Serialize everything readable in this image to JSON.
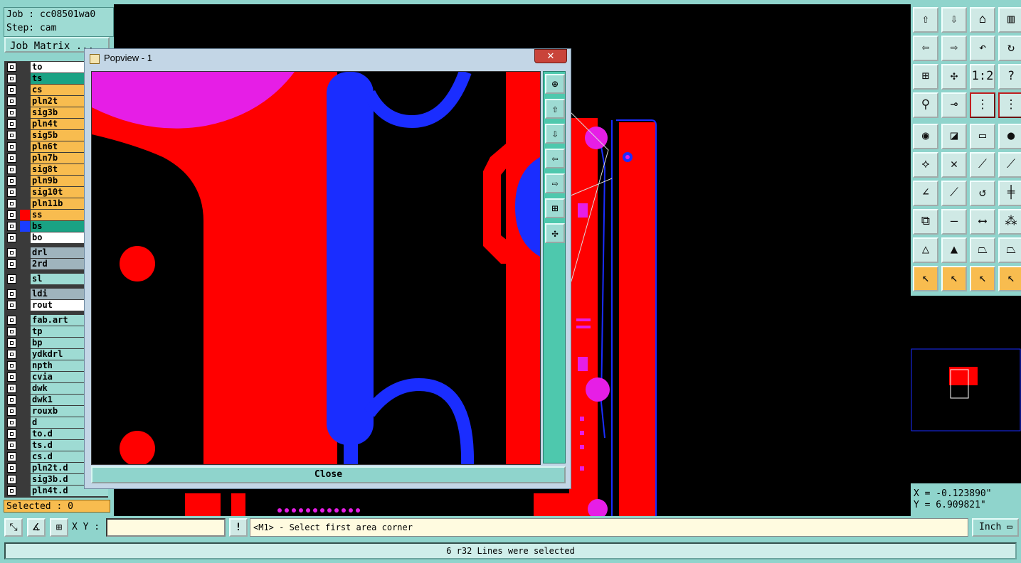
{
  "job": {
    "job_line": "Job : cc08501wa0",
    "step_line": "Step: cam",
    "matrix_label": "Job Matrix ..."
  },
  "layers": [
    {
      "name": "to",
      "fill": "#ffffff",
      "color": ""
    },
    {
      "name": "ts",
      "fill": "#1aa284",
      "color": ""
    },
    {
      "name": "cs",
      "fill": "#f8bc4f",
      "color": ""
    },
    {
      "name": "pln2t",
      "fill": "#f8bc4f",
      "color": ""
    },
    {
      "name": "sig3b",
      "fill": "#f8bc4f",
      "color": ""
    },
    {
      "name": "pln4t",
      "fill": "#f8bc4f",
      "color": ""
    },
    {
      "name": "sig5b",
      "fill": "#f8bc4f",
      "color": ""
    },
    {
      "name": "pln6t",
      "fill": "#f8bc4f",
      "color": ""
    },
    {
      "name": "pln7b",
      "fill": "#f8bc4f",
      "color": ""
    },
    {
      "name": "sig8t",
      "fill": "#f8bc4f",
      "color": ""
    },
    {
      "name": "pln9b",
      "fill": "#f8bc4f",
      "color": ""
    },
    {
      "name": "sig10t",
      "fill": "#f8bc4f",
      "color": ""
    },
    {
      "name": "pln11b",
      "fill": "#f8bc4f",
      "color": ""
    },
    {
      "name": "ss",
      "fill": "#f8bc4f",
      "color": "#ff0000"
    },
    {
      "name": "bs",
      "fill": "#1aa284",
      "color": "#1a3dff"
    },
    {
      "name": "bo",
      "fill": "#ffffff",
      "color": ""
    },
    {
      "name": "drl",
      "fill": "#9fb4bd",
      "color": ""
    },
    {
      "name": "2rd",
      "fill": "#9fb4bd",
      "color": ""
    },
    {
      "name": "sl",
      "fill": "#9edbd3",
      "color": ""
    },
    {
      "name": "ldi",
      "fill": "#9fb4bd",
      "color": ""
    },
    {
      "name": "rout",
      "fill": "#ffffff",
      "color": ""
    },
    {
      "name": "fab.art",
      "fill": "#9edbd3",
      "color": ""
    },
    {
      "name": "tp",
      "fill": "#9edbd3",
      "color": ""
    },
    {
      "name": "bp",
      "fill": "#9edbd3",
      "color": ""
    },
    {
      "name": "ydkdrl",
      "fill": "#9edbd3",
      "color": ""
    },
    {
      "name": "npth",
      "fill": "#9edbd3",
      "color": ""
    },
    {
      "name": "cvia",
      "fill": "#9edbd3",
      "color": ""
    },
    {
      "name": "dwk",
      "fill": "#9edbd3",
      "color": ""
    },
    {
      "name": "dwk1",
      "fill": "#9edbd3",
      "color": ""
    },
    {
      "name": "rouxb",
      "fill": "#9edbd3",
      "color": ""
    },
    {
      "name": "d",
      "fill": "#9edbd3",
      "color": ""
    },
    {
      "name": "to.d",
      "fill": "#9edbd3",
      "color": ""
    },
    {
      "name": "ts.d",
      "fill": "#9edbd3",
      "color": ""
    },
    {
      "name": "cs.d",
      "fill": "#9edbd3",
      "color": ""
    },
    {
      "name": "pln2t.d",
      "fill": "#9edbd3",
      "color": ""
    },
    {
      "name": "sig3b.d",
      "fill": "#9edbd3",
      "color": ""
    },
    {
      "name": "pln4t.d",
      "fill": "#9edbd3",
      "color": ""
    }
  ],
  "selected": "Selected : 0",
  "popview": {
    "title": "Popview - 1",
    "close_x": "✕",
    "close_button": "Close",
    "tools": [
      "zoom-in-icon",
      "move-up-icon",
      "move-down-icon",
      "move-left-icon",
      "move-right-icon",
      "zoom-fit-icon",
      "zoom-center-icon"
    ]
  },
  "right_tools": [
    {
      "icon": "window-up-icon",
      "glyph": "⇧"
    },
    {
      "icon": "window-down-icon",
      "glyph": "⇩"
    },
    {
      "icon": "home-icon",
      "glyph": "⌂"
    },
    {
      "icon": "grid-window-icon",
      "glyph": "▥"
    },
    {
      "icon": "pan-left-icon",
      "glyph": "⇦"
    },
    {
      "icon": "pan-right-icon",
      "glyph": "⇨"
    },
    {
      "icon": "undo-view-icon",
      "glyph": "↶"
    },
    {
      "icon": "redraw-icon",
      "glyph": "↻"
    },
    {
      "icon": "zoom-fit-icon",
      "glyph": "⊞"
    },
    {
      "icon": "zoom-home-icon",
      "glyph": "✣"
    },
    {
      "icon": "scale-1-2-icon",
      "glyph": "1:2"
    },
    {
      "icon": "help-icon",
      "glyph": "?"
    },
    {
      "icon": "probe-icon",
      "glyph": "⚲"
    },
    {
      "icon": "drill-icon",
      "glyph": "⊸"
    },
    {
      "icon": "net-icon",
      "glyph": "⋮"
    },
    {
      "icon": "net-alt-icon",
      "glyph": "⋮"
    },
    {
      "icon": "pad-select-icon",
      "glyph": "◉"
    },
    {
      "icon": "color-fill-icon",
      "glyph": "◪"
    },
    {
      "icon": "ruler-icon",
      "glyph": "▭"
    },
    {
      "icon": "dot-icon",
      "glyph": "●"
    },
    {
      "icon": "connect-icon",
      "glyph": "⟡"
    },
    {
      "icon": "cross-icon",
      "glyph": "✕"
    },
    {
      "icon": "line-node-icon",
      "glyph": "⟋"
    },
    {
      "icon": "line-node-alt-icon",
      "glyph": "⟋"
    },
    {
      "icon": "angle-icon",
      "glyph": "∠"
    },
    {
      "icon": "diagonal-icon",
      "glyph": "⟋"
    },
    {
      "icon": "arc-icon",
      "glyph": "↺"
    },
    {
      "icon": "split-icon",
      "glyph": "╪"
    },
    {
      "icon": "pad-move-icon",
      "glyph": "⧉"
    },
    {
      "icon": "line-icon",
      "glyph": "—"
    },
    {
      "icon": "measure-icon",
      "glyph": "⟷"
    },
    {
      "icon": "pads-icon",
      "glyph": "⁂"
    },
    {
      "icon": "triangle-icon",
      "glyph": "△"
    },
    {
      "icon": "triangle-up-icon",
      "glyph": "▲"
    },
    {
      "icon": "trapezoid-icon",
      "glyph": "⏢"
    },
    {
      "icon": "trapezoid-alt-icon",
      "glyph": "⏢"
    },
    {
      "icon": "pointer-icon",
      "glyph": "↖"
    },
    {
      "icon": "pointer-box-icon",
      "glyph": "↖"
    },
    {
      "icon": "pointer-circle-icon",
      "glyph": "↖"
    },
    {
      "icon": "pointer-step-icon",
      "glyph": "↖"
    }
  ],
  "coords": {
    "x": "X = -0.123890\"",
    "y": "Y = 6.909821\""
  },
  "bottom": {
    "xy_label": "X Y :",
    "xy_value": "",
    "excl": "!",
    "prompt": "<M1> - Select first area corner",
    "unit": "Inch ▭"
  },
  "status": "6 r32 Lines were selected",
  "colors": {
    "red": "#ff0000",
    "blue": "#1a2dff",
    "magenta": "#e61ee6",
    "teal": "#8fd4cc",
    "orange": "#f8bc4f"
  }
}
